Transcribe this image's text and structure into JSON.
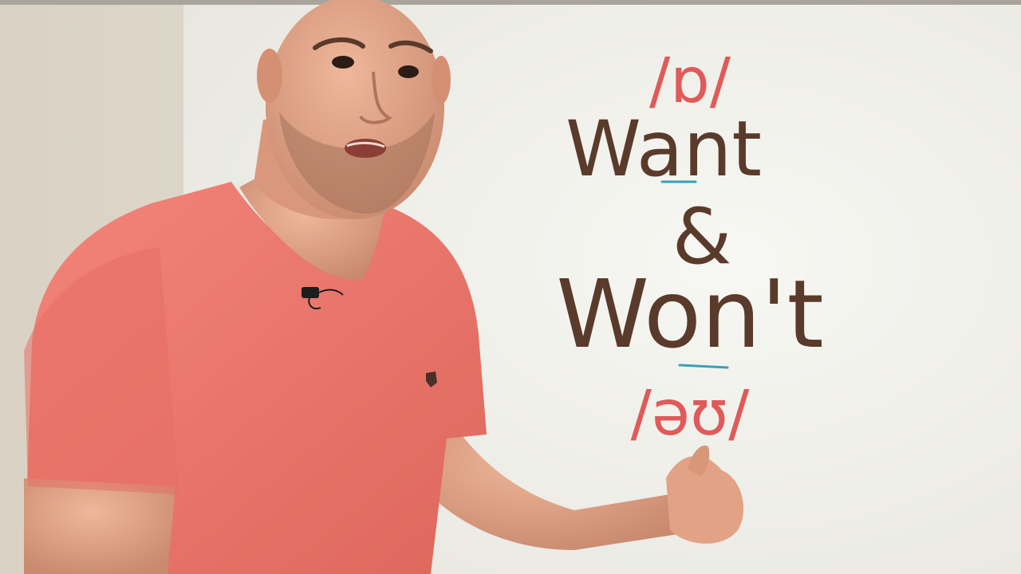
{
  "whiteboard": {
    "top_phoneme": "/ɒ/",
    "word_top": "Want",
    "ampersand": "&",
    "word_bottom": "Won't",
    "bottom_phoneme": "/əʊ/",
    "ink_color_words": "#5a3a2a",
    "ink_color_phonemes": "#e05a5a",
    "ink_color_underline": "#3aa0b8"
  },
  "scene": {
    "wall_color": "#e6e2d8",
    "board_color": "#f3f3ee",
    "shirt_color": "#f07a6e",
    "skin_color": "#e4a58a"
  }
}
